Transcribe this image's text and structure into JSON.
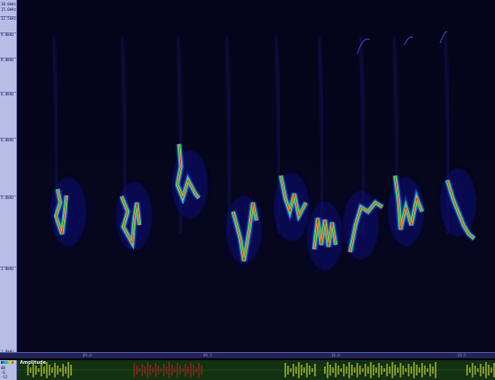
{
  "window": {
    "top_tab_label": ""
  },
  "freq_axis": {
    "labels": [
      "18.0kHz",
      "15.0kHz",
      "12.5kHz",
      "9.0kHz",
      "8.0kHz",
      "6.0kHz",
      "6.0kHz",
      "5.0kHz",
      "3.0kHz",
      "1.0kHz"
    ]
  },
  "time_ruler": {
    "labels": [
      "09.0",
      "09.5",
      "10.0",
      "10.5"
    ]
  },
  "amplitude": {
    "title": "Amplitude",
    "axis_labels": [
      "dB",
      "-6",
      "-12"
    ]
  },
  "colors": {
    "background": "#000010",
    "axis_panel": "#b9bde6",
    "amplitude_background": "#123212",
    "waveform_yellow": "#e8f040",
    "waveform_red": "#c02020",
    "colormap": [
      "#10107a",
      "#2a3ad0",
      "#18c8e8",
      "#20d060",
      "#e8e020",
      "#e02020"
    ]
  }
}
